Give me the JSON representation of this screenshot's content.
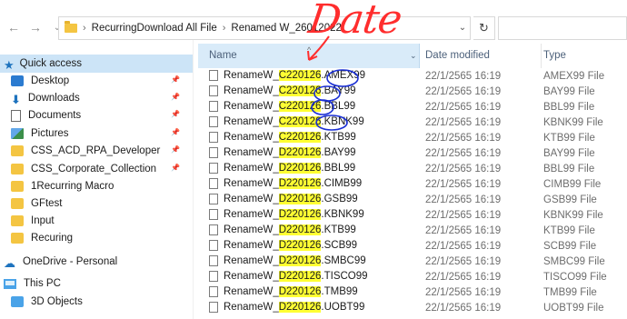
{
  "address": {
    "crumbs": [
      "RecurringDownload All File",
      "Renamed W_26012022"
    ]
  },
  "annotation": {
    "text": "Date"
  },
  "nav": {
    "items": [
      {
        "label": "Quick access",
        "icon": "star-icon",
        "selected": true,
        "pinned": false
      },
      {
        "label": "Desktop",
        "icon": "desktop-folder-icon",
        "pinned": true
      },
      {
        "label": "Downloads",
        "icon": "download-icon",
        "pinned": true
      },
      {
        "label": "Documents",
        "icon": "document-icon",
        "pinned": true
      },
      {
        "label": "Pictures",
        "icon": "picture-icon",
        "pinned": true
      },
      {
        "label": "CSS_ACD_RPA_Developer",
        "icon": "folder-icon",
        "pinned": true
      },
      {
        "label": "CSS_Corporate_Collection",
        "icon": "folder-icon",
        "pinned": true
      },
      {
        "label": "1Recurring Macro",
        "icon": "folder-icon",
        "pinned": false
      },
      {
        "label": "GFtest",
        "icon": "folder-icon",
        "pinned": false
      },
      {
        "label": "Input",
        "icon": "folder-icon",
        "pinned": false
      },
      {
        "label": "Recuring",
        "icon": "folder-icon",
        "pinned": false
      },
      {
        "label": "OneDrive - Personal",
        "icon": "cloud-icon",
        "pinned": false
      },
      {
        "label": "This PC",
        "icon": "pc-icon",
        "pinned": false
      },
      {
        "label": "3D Objects",
        "icon": "3d-objects-icon",
        "pinned": false
      }
    ]
  },
  "columns": {
    "name": "Name",
    "modified": "Date modified",
    "type": "Type"
  },
  "files": [
    {
      "prefix": "RenameW_",
      "date": "C220126",
      "suffix": ".AMEX99",
      "modified": "22/1/2565 16:19",
      "type": "AMEX99 File"
    },
    {
      "prefix": "RenameW_",
      "date": "C220126",
      "suffix": ".BAY99",
      "modified": "22/1/2565 16:19",
      "type": "BAY99 File"
    },
    {
      "prefix": "RenameW_",
      "date": "C220126",
      "suffix": ".BBL99",
      "modified": "22/1/2565 16:19",
      "type": "BBL99 File"
    },
    {
      "prefix": "RenameW_",
      "date": "C220126",
      "suffix": ".KBNK99",
      "modified": "22/1/2565 16:19",
      "type": "KBNK99 File"
    },
    {
      "prefix": "RenameW_",
      "date": "C220126",
      "suffix": ".KTB99",
      "modified": "22/1/2565 16:19",
      "type": "KTB99 File"
    },
    {
      "prefix": "RenameW_",
      "date": "D220126",
      "suffix": ".BAY99",
      "modified": "22/1/2565 16:19",
      "type": "BAY99 File"
    },
    {
      "prefix": "RenameW_",
      "date": "D220126",
      "suffix": ".BBL99",
      "modified": "22/1/2565 16:19",
      "type": "BBL99 File"
    },
    {
      "prefix": "RenameW_",
      "date": "D220126",
      "suffix": ".CIMB99",
      "modified": "22/1/2565 16:19",
      "type": "CIMB99 File"
    },
    {
      "prefix": "RenameW_",
      "date": "D220126",
      "suffix": ".GSB99",
      "modified": "22/1/2565 16:19",
      "type": "GSB99 File"
    },
    {
      "prefix": "RenameW_",
      "date": "D220126",
      "suffix": ".KBNK99",
      "modified": "22/1/2565 16:19",
      "type": "KBNK99 File"
    },
    {
      "prefix": "RenameW_",
      "date": "D220126",
      "suffix": ".KTB99",
      "modified": "22/1/2565 16:19",
      "type": "KTB99 File"
    },
    {
      "prefix": "RenameW_",
      "date": "D220126",
      "suffix": ".SCB99",
      "modified": "22/1/2565 16:19",
      "type": "SCB99 File"
    },
    {
      "prefix": "RenameW_",
      "date": "D220126",
      "suffix": ".SMBC99",
      "modified": "22/1/2565 16:19",
      "type": "SMBC99 File"
    },
    {
      "prefix": "RenameW_",
      "date": "D220126",
      "suffix": ".TISCO99",
      "modified": "22/1/2565 16:19",
      "type": "TISCO99 File"
    },
    {
      "prefix": "RenameW_",
      "date": "D220126",
      "suffix": ".TMB99",
      "modified": "22/1/2565 16:19",
      "type": "TMB99 File"
    },
    {
      "prefix": "RenameW_",
      "date": "D220126",
      "suffix": ".UOBT99",
      "modified": "22/1/2565 16:19",
      "type": "UOBT99 File"
    }
  ],
  "colors": {
    "highlight": "#ffff33",
    "annotation_red": "#ff2d2d",
    "annotation_blue": "#1a2fd4",
    "selection": "#cce4f7"
  }
}
